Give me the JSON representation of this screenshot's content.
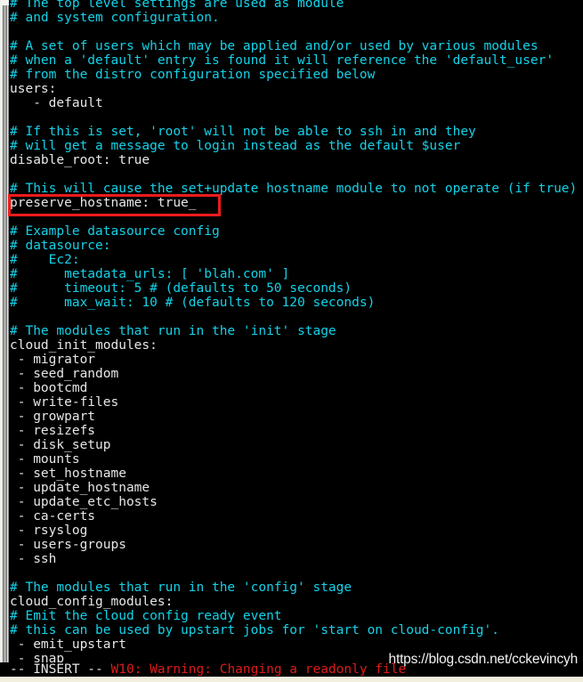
{
  "app": {
    "kind": "terminal-text-editor",
    "editor": "vim",
    "colors": {
      "background": "#000000",
      "comment": "#14d2e8",
      "text": "#e6e6e6",
      "warning": "#e01b1b",
      "annotation_box": "#ef1b1b",
      "chrome": "#e6e6e2"
    }
  },
  "buffer": {
    "lines": [
      {
        "text": "# The top level settings are used as module",
        "type": "comment"
      },
      {
        "text": "# and system configuration.",
        "type": "comment"
      },
      {
        "text": "",
        "type": "blank"
      },
      {
        "text": "# A set of users which may be applied and/or used by various modules",
        "type": "comment"
      },
      {
        "text": "# when a 'default' entry is found it will reference the 'default_user'",
        "type": "comment"
      },
      {
        "text": "# from the distro configuration specified below",
        "type": "comment"
      },
      {
        "text": "users:",
        "type": "text"
      },
      {
        "text": "   - default",
        "type": "text"
      },
      {
        "text": "",
        "type": "blank"
      },
      {
        "text": "# If this is set, 'root' will not be able to ssh in and they",
        "type": "comment"
      },
      {
        "text": "# will get a message to login instead as the default $user",
        "type": "comment"
      },
      {
        "text": "disable_root: true",
        "type": "text"
      },
      {
        "text": "",
        "type": "blank"
      },
      {
        "text": "# This will cause the set+update hostname module to not operate (if true)",
        "type": "comment"
      },
      {
        "text": "preserve_hostname: true_",
        "type": "text"
      },
      {
        "text": "",
        "type": "blank"
      },
      {
        "text": "# Example datasource config",
        "type": "comment"
      },
      {
        "text": "# datasource:",
        "type": "comment"
      },
      {
        "text": "#    Ec2:",
        "type": "comment"
      },
      {
        "text": "#      metadata_urls: [ 'blah.com' ]",
        "type": "comment"
      },
      {
        "text": "#      timeout: 5 # (defaults to 50 seconds)",
        "type": "comment"
      },
      {
        "text": "#      max_wait: 10 # (defaults to 120 seconds)",
        "type": "comment"
      },
      {
        "text": "",
        "type": "blank"
      },
      {
        "text": "# The modules that run in the 'init' stage",
        "type": "comment"
      },
      {
        "text": "cloud_init_modules:",
        "type": "text"
      },
      {
        "text": " - migrator",
        "type": "text"
      },
      {
        "text": " - seed_random",
        "type": "text"
      },
      {
        "text": " - bootcmd",
        "type": "text"
      },
      {
        "text": " - write-files",
        "type": "text"
      },
      {
        "text": " - growpart",
        "type": "text"
      },
      {
        "text": " - resizefs",
        "type": "text"
      },
      {
        "text": " - disk_setup",
        "type": "text"
      },
      {
        "text": " - mounts",
        "type": "text"
      },
      {
        "text": " - set_hostname",
        "type": "text"
      },
      {
        "text": " - update_hostname",
        "type": "text"
      },
      {
        "text": " - update_etc_hosts",
        "type": "text"
      },
      {
        "text": " - ca-certs",
        "type": "text"
      },
      {
        "text": " - rsyslog",
        "type": "text"
      },
      {
        "text": " - users-groups",
        "type": "text"
      },
      {
        "text": " - ssh",
        "type": "text"
      },
      {
        "text": "",
        "type": "blank"
      },
      {
        "text": "# The modules that run in the 'config' stage",
        "type": "comment"
      },
      {
        "text": "cloud_config_modules:",
        "type": "text"
      },
      {
        "text": "# Emit the cloud config ready event",
        "type": "comment"
      },
      {
        "text": "# this can be used by upstart jobs for 'start on cloud-config'.",
        "type": "comment"
      },
      {
        "text": " - emit_upstart",
        "type": "text"
      },
      {
        "text": " - snap",
        "type": "text"
      }
    ]
  },
  "annotation": {
    "target_line": "preserve_hostname: true_",
    "box_color": "#ef1b1b"
  },
  "status_line": {
    "mode": "-- INSERT -- ",
    "message": "W10: Warning: Changing a readonly file"
  },
  "watermark": {
    "text": "https://blog.csdn.net/cckevincyh"
  }
}
